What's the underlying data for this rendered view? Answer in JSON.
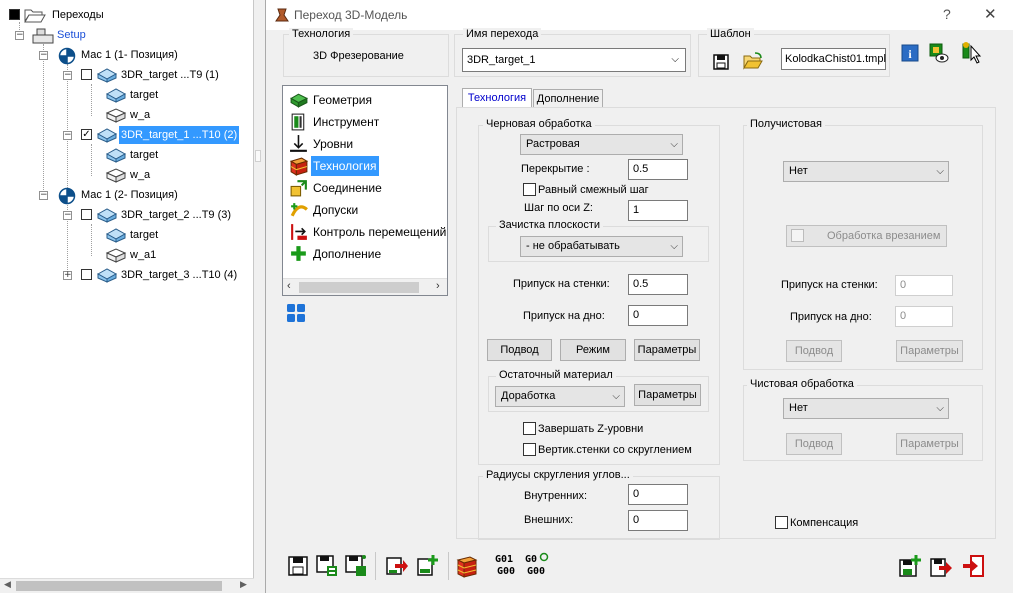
{
  "tree": {
    "root_label": "Переходы",
    "setup_label": "Setup",
    "pos1_label": "Мас 1 (1- Позиция)",
    "pos2_label": "Мас 1 (2- Позиция)",
    "op1_label": "3DR_target ...T9 (1)",
    "op2_label": "3DR_target_1 ...T10 (2)",
    "op3_label": "3DR_target_2 ...T9 (3)",
    "op4_label": "3DR_target_3 ...T10 (4)",
    "op1_child1": "target",
    "op1_child2": "w_a",
    "op2_child1": "target",
    "op2_child2": "w_a",
    "op3_child1": "target",
    "op3_child2": "w_a1"
  },
  "dialog": {
    "title": "Переход 3D-Модель",
    "help_glyph": "?",
    "close_glyph": "✕"
  },
  "header": {
    "tech_group": "Технология",
    "tech_value": "3D Фрезерование",
    "name_group": "Имя перехода",
    "name_value": "3DR_target_1",
    "template_group": "Шаблон",
    "template_value": "KolodkaChist01.tmpl"
  },
  "nav": {
    "items": [
      {
        "label": "Геометрия",
        "icon": "geometry-icon"
      },
      {
        "label": "Инструмент",
        "icon": "tool-icon"
      },
      {
        "label": "Уровни",
        "icon": "levels-icon"
      },
      {
        "label": "Технология",
        "icon": "technology-icon"
      },
      {
        "label": "Соединение",
        "icon": "link-icon"
      },
      {
        "label": "Допуски",
        "icon": "tolerance-icon"
      },
      {
        "label": "Контроль перемещений",
        "icon": "collision-control-icon"
      },
      {
        "label": "Дополнение",
        "icon": "addition-icon"
      }
    ],
    "active_index": 3
  },
  "tabs": {
    "tab1": "Технология",
    "tab2": "Дополнение",
    "active": "Технология"
  },
  "rough": {
    "group": "Черновая обработка",
    "strategy": "Растровая",
    "overlap_label": "Перекрытие :",
    "overlap_value": "0.5",
    "equal_step_label": "Равный смежный шаг",
    "equal_step_checked": false,
    "zstep_label": "Шаг по оси Z:",
    "zstep_value": "1",
    "flat_group": "Зачистка плоскости",
    "flat_value": "- не обрабатывать",
    "wall_allow_label": "Припуск на стенки:",
    "wall_allow_value": "0.5",
    "floor_allow_label": "Припуск на дно:",
    "floor_allow_value": "0",
    "approach_btn": "Подвод",
    "mode_btn": "Режим",
    "params_btn": "Параметры",
    "rest_group": "Остаточный материал",
    "rest_value": "Доработка",
    "rest_params_btn": "Параметры",
    "finish_z_label": "Завершать Z-уровни",
    "finish_z_checked": false,
    "vert_walls_label": "Вертик.стенки со скруглением",
    "vert_walls_checked": false
  },
  "radii": {
    "group": "Радиусы скругления углов...",
    "inner_label": "Внутренних:",
    "inner_value": "0",
    "outer_label": "Внешних:",
    "outer_value": "0"
  },
  "semifinish": {
    "group": "Получистовая",
    "strategy": "Нет",
    "plunge_label": "Обработка врезанием",
    "wall_allow_label": "Припуск на стенки:",
    "wall_allow_value": "0",
    "floor_allow_label": "Припуск на дно:",
    "floor_allow_value": "0",
    "approach_btn": "Подвод",
    "params_btn": "Параметры"
  },
  "finish": {
    "group": "Чистовая обработка",
    "strategy": "Нет",
    "approach_btn": "Подвод",
    "params_btn": "Параметры"
  },
  "compensation": {
    "label": "Компенсация",
    "checked": false
  },
  "toolbar": {
    "g01": "G01",
    "g00a": "G00",
    "g0": "G0",
    "g00b": "G00"
  },
  "colors": {
    "selection": "#3399ff",
    "tab_active_text": "#0000cc",
    "red_arrow": "#cc1010",
    "green_plus": "#1a9a1a"
  }
}
